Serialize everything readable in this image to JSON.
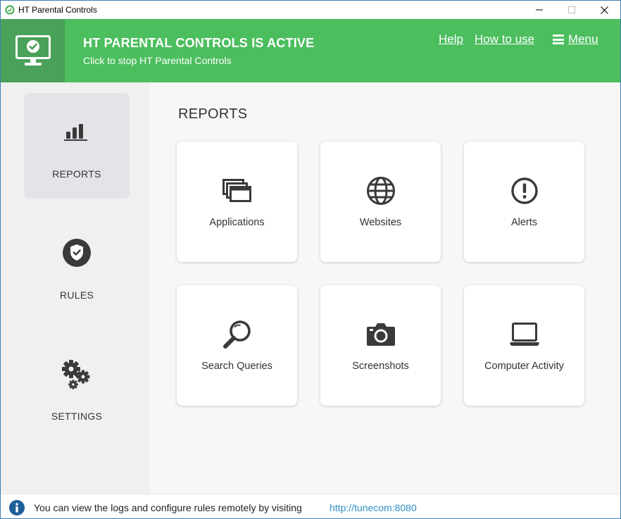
{
  "window": {
    "title": "HT Parental Controls"
  },
  "header": {
    "status_title": "HT PARENTAL CONTROLS IS ACTIVE",
    "status_subtitle": "Click to stop HT Parental Controls",
    "links": {
      "help": "Help",
      "how_to_use": "How to use",
      "menu": "Menu"
    }
  },
  "sidebar": {
    "items": [
      {
        "label": "REPORTS",
        "icon": "bar-chart-icon",
        "active": true
      },
      {
        "label": "RULES",
        "icon": "shield-check-icon",
        "active": false
      },
      {
        "label": "SETTINGS",
        "icon": "gears-icon",
        "active": false
      }
    ]
  },
  "main": {
    "title": "REPORTS",
    "cards": [
      {
        "label": "Applications",
        "icon": "windows-stack-icon"
      },
      {
        "label": "Websites",
        "icon": "globe-icon"
      },
      {
        "label": "Alerts",
        "icon": "alert-circle-icon"
      },
      {
        "label": "Search Queries",
        "icon": "magnifier-icon"
      },
      {
        "label": "Screenshots",
        "icon": "camera-icon"
      },
      {
        "label": "Computer Activity",
        "icon": "laptop-icon"
      }
    ]
  },
  "footer": {
    "message": "You can view the logs and configure rules remotely by visiting",
    "link": "http://tunecom:8080"
  },
  "colors": {
    "header_green": "#4cbe5e",
    "header_icon_bg": "#4aa159",
    "icon_dark": "#3a3a3a",
    "link_blue": "#2f8fc1",
    "info_blue": "#1e5e9a"
  }
}
